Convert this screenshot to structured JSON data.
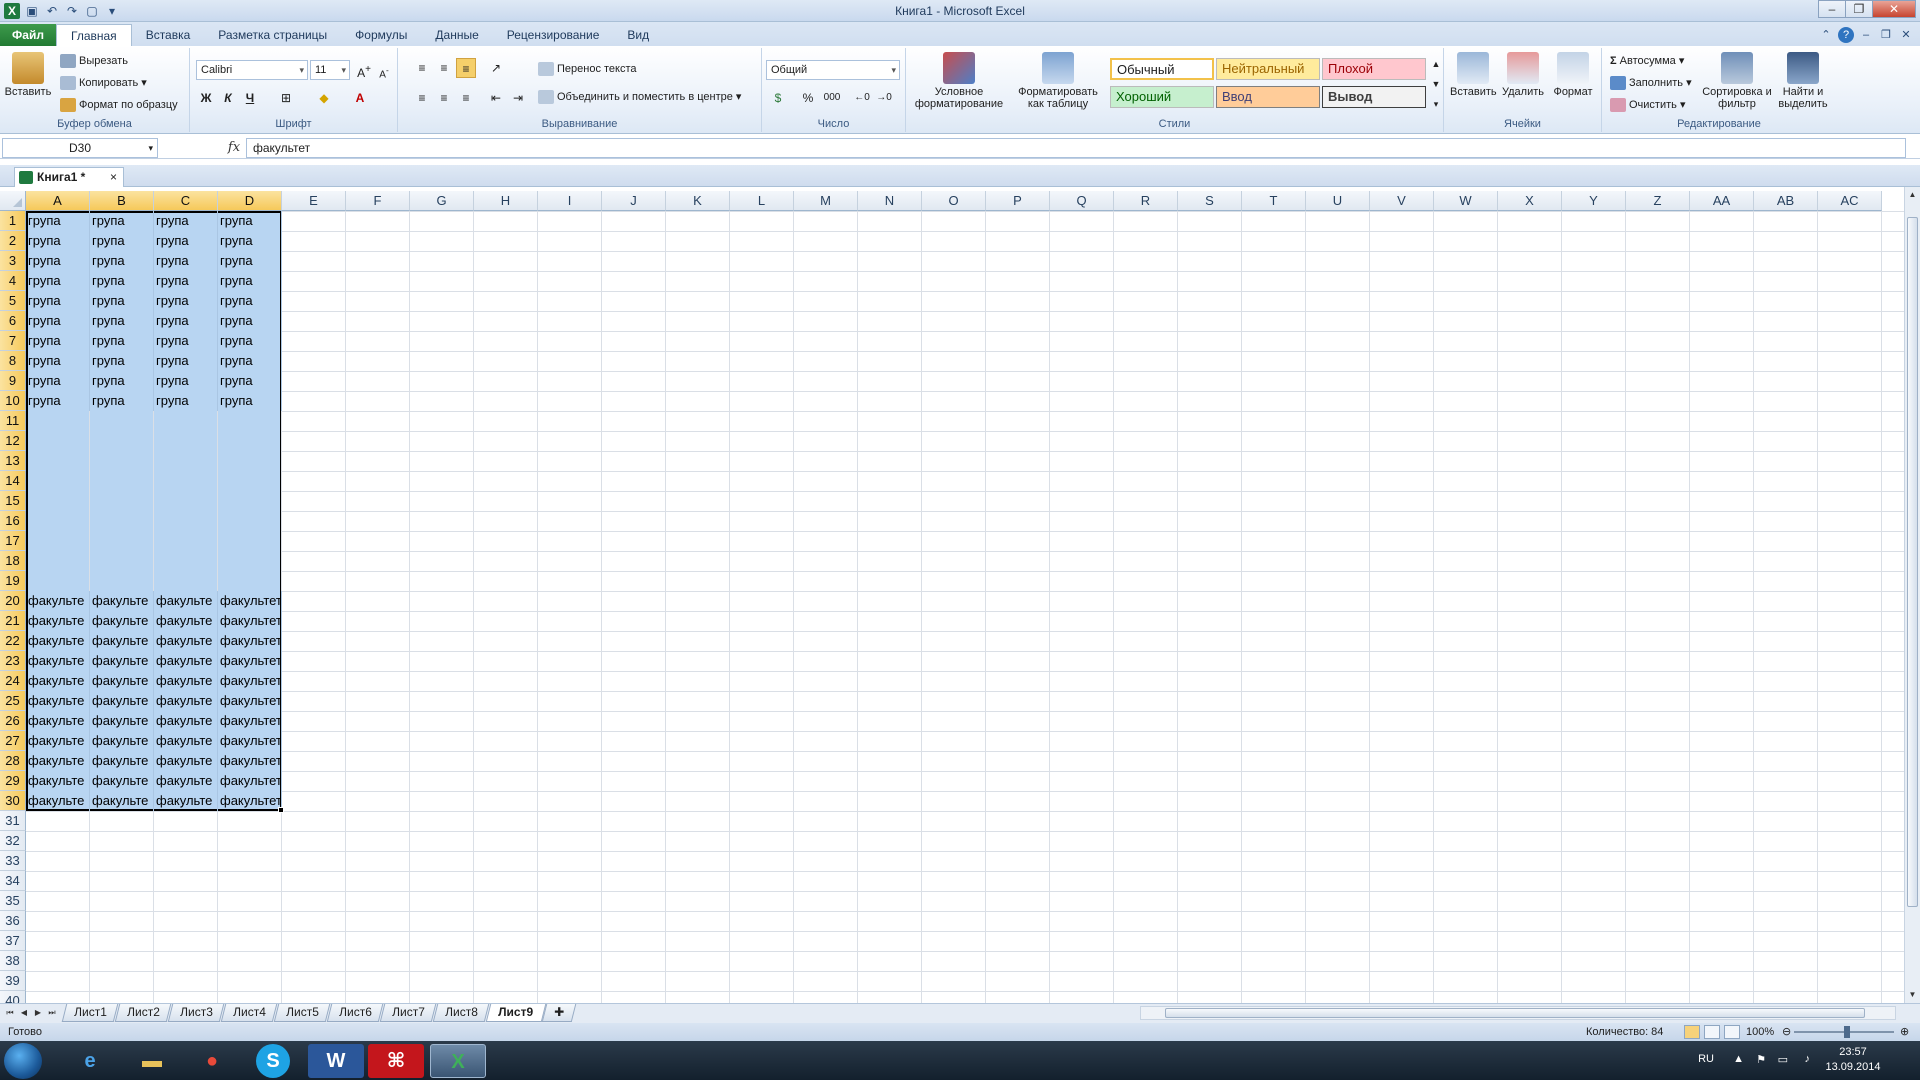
{
  "window": {
    "title": "Книга1 - Microsoft Excel"
  },
  "ribbon_tabs": [
    "Файл",
    "Главная",
    "Вставка",
    "Разметка страницы",
    "Формулы",
    "Данные",
    "Рецензирование",
    "Вид"
  ],
  "active_tab": "Главная",
  "clipboard": {
    "paste": "Вставить",
    "cut": "Вырезать",
    "copy": "Копировать",
    "format_painter": "Формат по образцу",
    "label": "Буфер обмена"
  },
  "font": {
    "name": "Calibri",
    "size": "11",
    "bold": "Ж",
    "italic": "К",
    "underline": "Ч",
    "label": "Шрифт"
  },
  "alignment": {
    "wrap_text": "Перенос текста",
    "merge_center": "Объединить и поместить в центре",
    "label": "Выравнивание"
  },
  "number": {
    "format": "Общий",
    "percent": "%",
    "thousands": "000",
    "label": "Число"
  },
  "styles": {
    "conditional": "Условное форматирование",
    "format_table": "Форматировать как таблицу",
    "normal": "Обычный",
    "neutral": "Нейтральный",
    "bad": "Плохой",
    "good": "Хороший",
    "input": "Ввод",
    "output": "Вывод",
    "label": "Стили"
  },
  "cells_group": {
    "insert": "Вставить",
    "delete": "Удалить",
    "format": "Формат",
    "label": "Ячейки"
  },
  "editing": {
    "autosum": "Автосумма",
    "fill": "Заполнить",
    "clear": "Очистить",
    "sort_filter": "Сортировка и фильтр",
    "find_select": "Найти и выделить",
    "label": "Редактирование"
  },
  "formula_bar": {
    "name_box": "D30",
    "fx": "fx",
    "content": "факультет"
  },
  "workbook_tab": {
    "name": "Книга1 *",
    "close": "×"
  },
  "grid": {
    "columns": [
      "A",
      "B",
      "C",
      "D",
      "E",
      "F",
      "G",
      "H",
      "I",
      "J",
      "K",
      "L",
      "M",
      "N",
      "O",
      "P",
      "Q",
      "R",
      "S",
      "T",
      "U",
      "V",
      "W",
      "X",
      "Y",
      "Z",
      "AA",
      "AB",
      "AC"
    ],
    "selected_columns": [
      "A",
      "B",
      "C",
      "D"
    ],
    "row_count": 40,
    "selected_rows_through": 30,
    "top_block": {
      "rows_from": 1,
      "rows_to": 10,
      "text": "група"
    },
    "bottom_block": {
      "rows_from": 20,
      "rows_to": 30,
      "text": "факульте",
      "last_column_text": "факультет"
    }
  },
  "sheets": [
    "Лист1",
    "Лист2",
    "Лист3",
    "Лист4",
    "Лист5",
    "Лист6",
    "Лист7",
    "Лист8",
    "Лист9"
  ],
  "active_sheet": "Лист9",
  "status": {
    "ready": "Готово",
    "count": "Количество: 84",
    "zoom": "100%"
  },
  "taskbar": {
    "lang": "RU",
    "time": "23:57",
    "date": "13.09.2014"
  },
  "colors": {
    "selection_fill": "#b8d5f2",
    "header_selected": "#f6c95a",
    "file_tab": "#2a8a3a"
  }
}
